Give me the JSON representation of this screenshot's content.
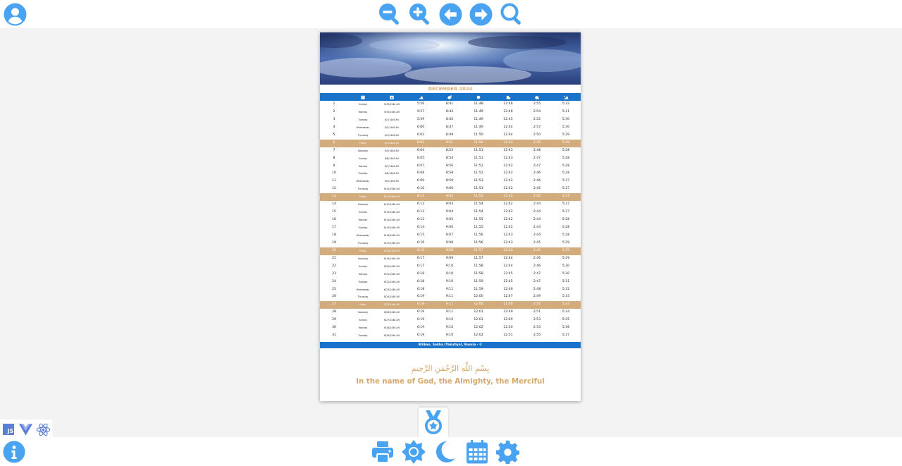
{
  "toolbar": {
    "icons": [
      "user-icon",
      "zoom-out-icon",
      "zoom-in-icon",
      "arrow-left-icon",
      "arrow-right-icon",
      "search-icon"
    ],
    "accent": "#4aa3f0"
  },
  "calendar": {
    "month_title": "DECEMBER 2024",
    "header_icons": [
      "calendar-icon",
      "calendar-hijri-icon",
      "fajr-icon",
      "sunrise-icon",
      "dhuhr-icon",
      "asr-icon",
      "maghrib-icon",
      "isha-icon"
    ],
    "rows": [
      {
        "d": "1",
        "wd": "Sunday",
        "h": "5/29/1446 AH",
        "t": [
          "5:56",
          "8:41",
          "11:48",
          "12:46",
          "2:55",
          "5:32"
        ],
        "fri": false
      },
      {
        "d": "2",
        "wd": "Monday",
        "h": "5/30/1446 AH",
        "t": [
          "5:57",
          "8:43",
          "11:49",
          "12:46",
          "2:54",
          "5:31"
        ],
        "fri": false
      },
      {
        "d": "3",
        "wd": "Tuesday",
        "h": "6/1/1446 AH",
        "t": [
          "5:59",
          "8:45",
          "11:49",
          "12:45",
          "2:52",
          "5:30"
        ],
        "fri": false
      },
      {
        "d": "4",
        "wd": "Wednesday",
        "h": "6/2/1446 AH",
        "t": [
          "6:00",
          "8:47",
          "11:49",
          "12:44",
          "2:57",
          "5:30"
        ],
        "fri": false
      },
      {
        "d": "5",
        "wd": "Thursday",
        "h": "6/3/1446 AH",
        "t": [
          "6:02",
          "8:49",
          "11:50",
          "12:44",
          "2:50",
          "5:29"
        ],
        "fri": false
      },
      {
        "d": "6",
        "wd": "Friday",
        "h": "6/4/1446 AH",
        "t": [
          "6:03",
          "8:51",
          "11:50",
          "12:43",
          "2:49",
          "5:28"
        ],
        "fri": true
      },
      {
        "d": "7",
        "wd": "Saturday",
        "h": "6/5/1446 AH",
        "t": [
          "6:04",
          "8:53",
          "11:51",
          "12:43",
          "2:48",
          "5:28"
        ],
        "fri": false
      },
      {
        "d": "8",
        "wd": "Sunday",
        "h": "6/6/1446 AH",
        "t": [
          "6:05",
          "8:54",
          "11:51",
          "12:43",
          "2:47",
          "5:28"
        ],
        "fri": false
      },
      {
        "d": "9",
        "wd": "Monday",
        "h": "6/7/1446 AH",
        "t": [
          "6:07",
          "8:56",
          "11:52",
          "12:42",
          "2:47",
          "5:28"
        ],
        "fri": false
      },
      {
        "d": "10",
        "wd": "Tuesday",
        "h": "6/8/1446 AH",
        "t": [
          "6:08",
          "8:58",
          "11:52",
          "12:42",
          "2:46",
          "5:28"
        ],
        "fri": false
      },
      {
        "d": "11",
        "wd": "Wednesday",
        "h": "6/9/1446 AH",
        "t": [
          "6:09",
          "8:59",
          "11:53",
          "12:42",
          "2:46",
          "5:27"
        ],
        "fri": false
      },
      {
        "d": "12",
        "wd": "Thursday",
        "h": "6/10/1446 AH",
        "t": [
          "6:10",
          "9:00",
          "11:53",
          "12:42",
          "2:45",
          "5:27"
        ],
        "fri": false
      },
      {
        "d": "13",
        "wd": "Friday",
        "h": "6/11/1446 AH",
        "t": [
          "6:11",
          "9:02",
          "11:53",
          "12:42",
          "2:45",
          "5:27"
        ],
        "fri": true
      },
      {
        "d": "14",
        "wd": "Saturday",
        "h": "6/12/1446 AH",
        "t": [
          "6:12",
          "9:03",
          "11:54",
          "12:42",
          "2:44",
          "5:27"
        ],
        "fri": false
      },
      {
        "d": "15",
        "wd": "Sunday",
        "h": "6/13/1446 AH",
        "t": [
          "6:13",
          "9:04",
          "11:54",
          "12:42",
          "2:44",
          "5:27"
        ],
        "fri": false
      },
      {
        "d": "16",
        "wd": "Monday",
        "h": "6/14/1446 AH",
        "t": [
          "6:13",
          "9:05",
          "11:55",
          "12:42",
          "2:44",
          "5:28"
        ],
        "fri": false
      },
      {
        "d": "17",
        "wd": "Tuesday",
        "h": "6/15/1446 AH",
        "t": [
          "6:14",
          "9:06",
          "11:55",
          "12:42",
          "2:44",
          "5:28"
        ],
        "fri": false
      },
      {
        "d": "18",
        "wd": "Wednesday",
        "h": "6/16/1446 AH",
        "t": [
          "6:15",
          "9:07",
          "11:56",
          "12:43",
          "2:44",
          "5:28"
        ],
        "fri": false
      },
      {
        "d": "19",
        "wd": "Thursday",
        "h": "6/17/1446 AH",
        "t": [
          "6:16",
          "9:08",
          "11:56",
          "12:43",
          "2:45",
          "5:29"
        ],
        "fri": false
      },
      {
        "d": "20",
        "wd": "Friday",
        "h": "6/18/1446 AH",
        "t": [
          "6:16",
          "9:08",
          "11:57",
          "12:43",
          "2:45",
          "5:29"
        ],
        "fri": true
      },
      {
        "d": "21",
        "wd": "Saturday",
        "h": "6/19/1446 AH",
        "t": [
          "6:17",
          "9:09",
          "11:57",
          "12:44",
          "2:46",
          "5:29"
        ],
        "fri": false
      },
      {
        "d": "22",
        "wd": "Sunday",
        "h": "6/20/1446 AH",
        "t": [
          "6:17",
          "9:10",
          "11:58",
          "12:44",
          "2:46",
          "5:30"
        ],
        "fri": false
      },
      {
        "d": "23",
        "wd": "Monday",
        "h": "6/21/1446 AH",
        "t": [
          "6:18",
          "9:10",
          "11:58",
          "12:45",
          "2:47",
          "5:30"
        ],
        "fri": false
      },
      {
        "d": "24",
        "wd": "Tuesday",
        "h": "6/22/1446 AH",
        "t": [
          "6:18",
          "9:10",
          "11:59",
          "12:45",
          "2:47",
          "5:31"
        ],
        "fri": false
      },
      {
        "d": "25",
        "wd": "Wednesday",
        "h": "6/23/1446 AH",
        "t": [
          "6:18",
          "9:11",
          "11:59",
          "12:46",
          "2:48",
          "5:32"
        ],
        "fri": false
      },
      {
        "d": "26",
        "wd": "Thursday",
        "h": "6/24/1446 AH",
        "t": [
          "6:19",
          "9:11",
          "12:00",
          "12:47",
          "2:49",
          "5:33"
        ],
        "fri": false
      },
      {
        "d": "27",
        "wd": "Friday",
        "h": "6/25/1446 AH",
        "t": [
          "6:19",
          "9:11",
          "12:00",
          "12:48",
          "2:50",
          "5:33"
        ],
        "fri": true
      },
      {
        "d": "28",
        "wd": "Saturday",
        "h": "6/26/1446 AH",
        "t": [
          "6:19",
          "9:11",
          "12:01",
          "12:49",
          "2:51",
          "5:34"
        ],
        "fri": false
      },
      {
        "d": "29",
        "wd": "Sunday",
        "h": "6/27/1446 AH",
        "t": [
          "6:19",
          "9:10",
          "12:01",
          "12:49",
          "2:53",
          "5:35"
        ],
        "fri": false
      },
      {
        "d": "30",
        "wd": "Monday",
        "h": "6/28/1446 AH",
        "t": [
          "6:19",
          "9:10",
          "12:02",
          "12:50",
          "2:54",
          "5:36"
        ],
        "fri": false
      },
      {
        "d": "31",
        "wd": "Tuesday",
        "h": "6/29/1446 AH",
        "t": [
          "6:19",
          "9:10",
          "12:02",
          "12:51",
          "2:55",
          "5:37"
        ],
        "fri": false
      }
    ],
    "footer": "Blilkan, Sakha (Yakutiya), Russia  ·  ©",
    "bismillah": "بِسْمِ اللَّهِ الرَّحْمَنِ الرَّحِيمِ",
    "tagline": "In the name of God, the Almighty, the Merciful",
    "colors": {
      "header_blue": "#1a73c9",
      "friday": "#d2ac7d",
      "gold_text": "#d7a96e"
    }
  },
  "tech_badges": {
    "js_label": "JS",
    "icons": [
      "js-icon",
      "vue-icon",
      "react-icon"
    ]
  },
  "bottom_toolbar": {
    "icons": [
      "info-icon",
      "print-icon",
      "brightness-icon",
      "dark-mode-icon",
      "calendar-icon",
      "settings-icon"
    ]
  },
  "achievement": {
    "icon": "medal-icon"
  }
}
